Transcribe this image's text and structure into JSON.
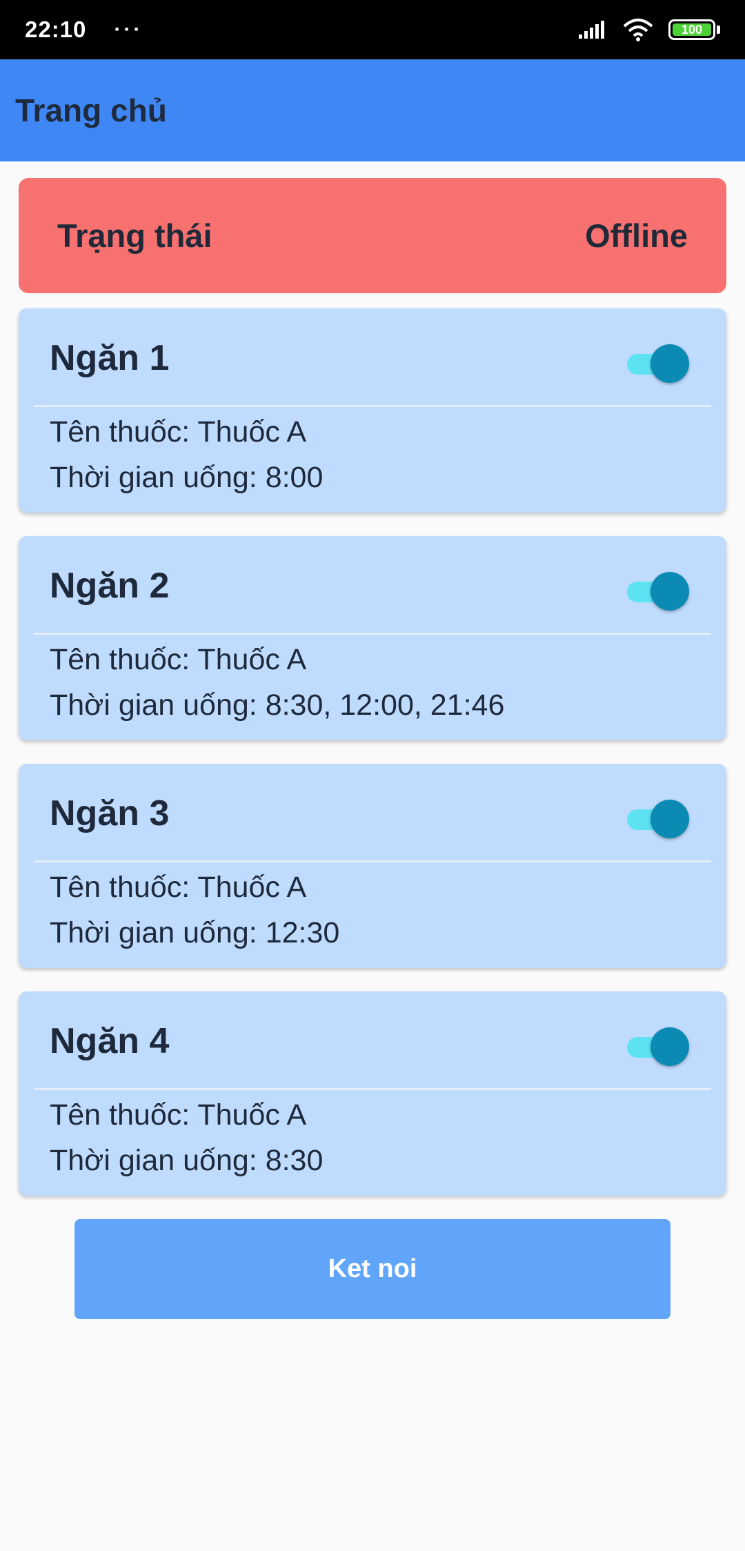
{
  "status_bar": {
    "time": "22:10",
    "dots": "···",
    "battery": "100"
  },
  "app_bar": {
    "title": "Trang chủ"
  },
  "connection": {
    "label": "Trạng thái",
    "value": "Offline"
  },
  "drawers": [
    {
      "title": "Ngăn 1",
      "medicine_label": "Tên thuốc: ",
      "medicine": "Thuốc A",
      "time_label": "Thời gian uống: ",
      "times": "8:00",
      "enabled": true
    },
    {
      "title": "Ngăn 2",
      "medicine_label": "Tên thuốc: ",
      "medicine": "Thuốc A",
      "time_label": "Thời gian uống: ",
      "times": "8:30, 12:00, 21:46",
      "enabled": true
    },
    {
      "title": "Ngăn 3",
      "medicine_label": "Tên thuốc: ",
      "medicine": "Thuốc A",
      "time_label": "Thời gian uống: ",
      "times": "12:30",
      "enabled": true
    },
    {
      "title": "Ngăn 4",
      "medicine_label": "Tên thuốc: ",
      "medicine": "Thuốc A",
      "time_label": "Thời gian uống: ",
      "times": "8:30",
      "enabled": true
    }
  ],
  "connect_button": {
    "label": "Ket noi"
  },
  "colors": {
    "app_bar": "#3f87f5",
    "offline": "#f87171",
    "card": "#bfdbfe",
    "toggle_thumb": "#0b8bb4",
    "toggle_track": "#5de2f2",
    "button": "#60a5fa"
  }
}
